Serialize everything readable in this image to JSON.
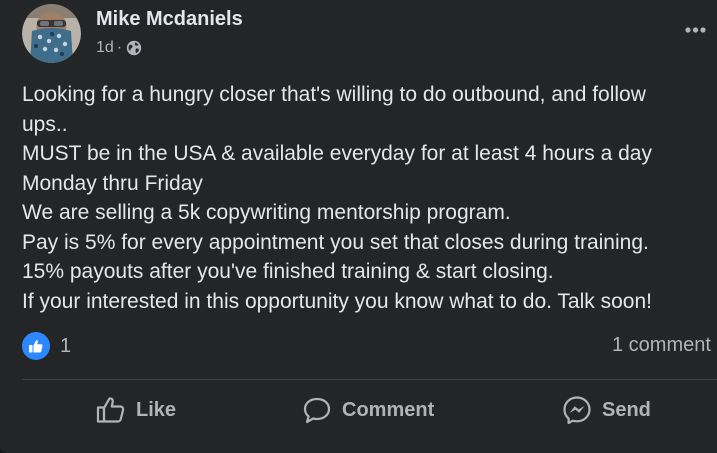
{
  "post": {
    "author": "Mike Mcdaniels",
    "timestamp": "1d",
    "separator": "·",
    "audience_icon": "public-globe-icon",
    "more_icon": "more-options-icon",
    "body_lines": [
      "Looking for a hungry closer that's willing to do outbound, and follow",
      "ups..",
      "MUST be in the USA & available everyday for at least 4 hours a day",
      "Monday thru Friday",
      "We are selling a 5k copywriting mentorship program.",
      "Pay is 5% for every appointment you set that closes during training.",
      "15% payouts after you've finished training & start closing.",
      "If your interested in this opportunity you know what to do. Talk soon!"
    ]
  },
  "reactions": {
    "icon": "like-reaction-icon",
    "count": "1",
    "comments": "1 comment"
  },
  "actions": {
    "like": "Like",
    "comment": "Comment",
    "send": "Send"
  },
  "colors": {
    "background": "#242526",
    "text": "#e4e6eb",
    "secondary_text": "#b0b3b8",
    "like_blue": "#2d88ff",
    "divider": "#3e4042"
  }
}
